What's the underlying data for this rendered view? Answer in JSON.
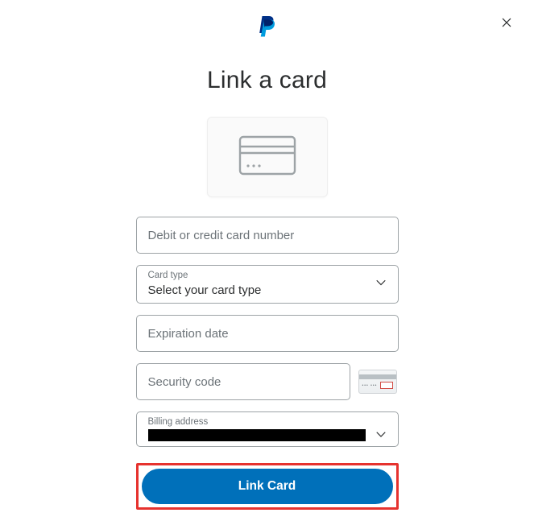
{
  "header": {
    "title": "Link a card"
  },
  "form": {
    "card_number_placeholder": "Debit or credit card number",
    "card_type_label": "Card type",
    "card_type_value": "Select your card type",
    "expiration_placeholder": "Expiration date",
    "security_code_placeholder": "Security code",
    "billing_label": "Billing address",
    "submit_label": "Link Card"
  },
  "icons": {
    "close": "close-icon",
    "logo": "paypal-logo",
    "card": "card-icon",
    "chevron": "chevron-down-icon",
    "cvv_hint": "cvv-hint-icon"
  }
}
